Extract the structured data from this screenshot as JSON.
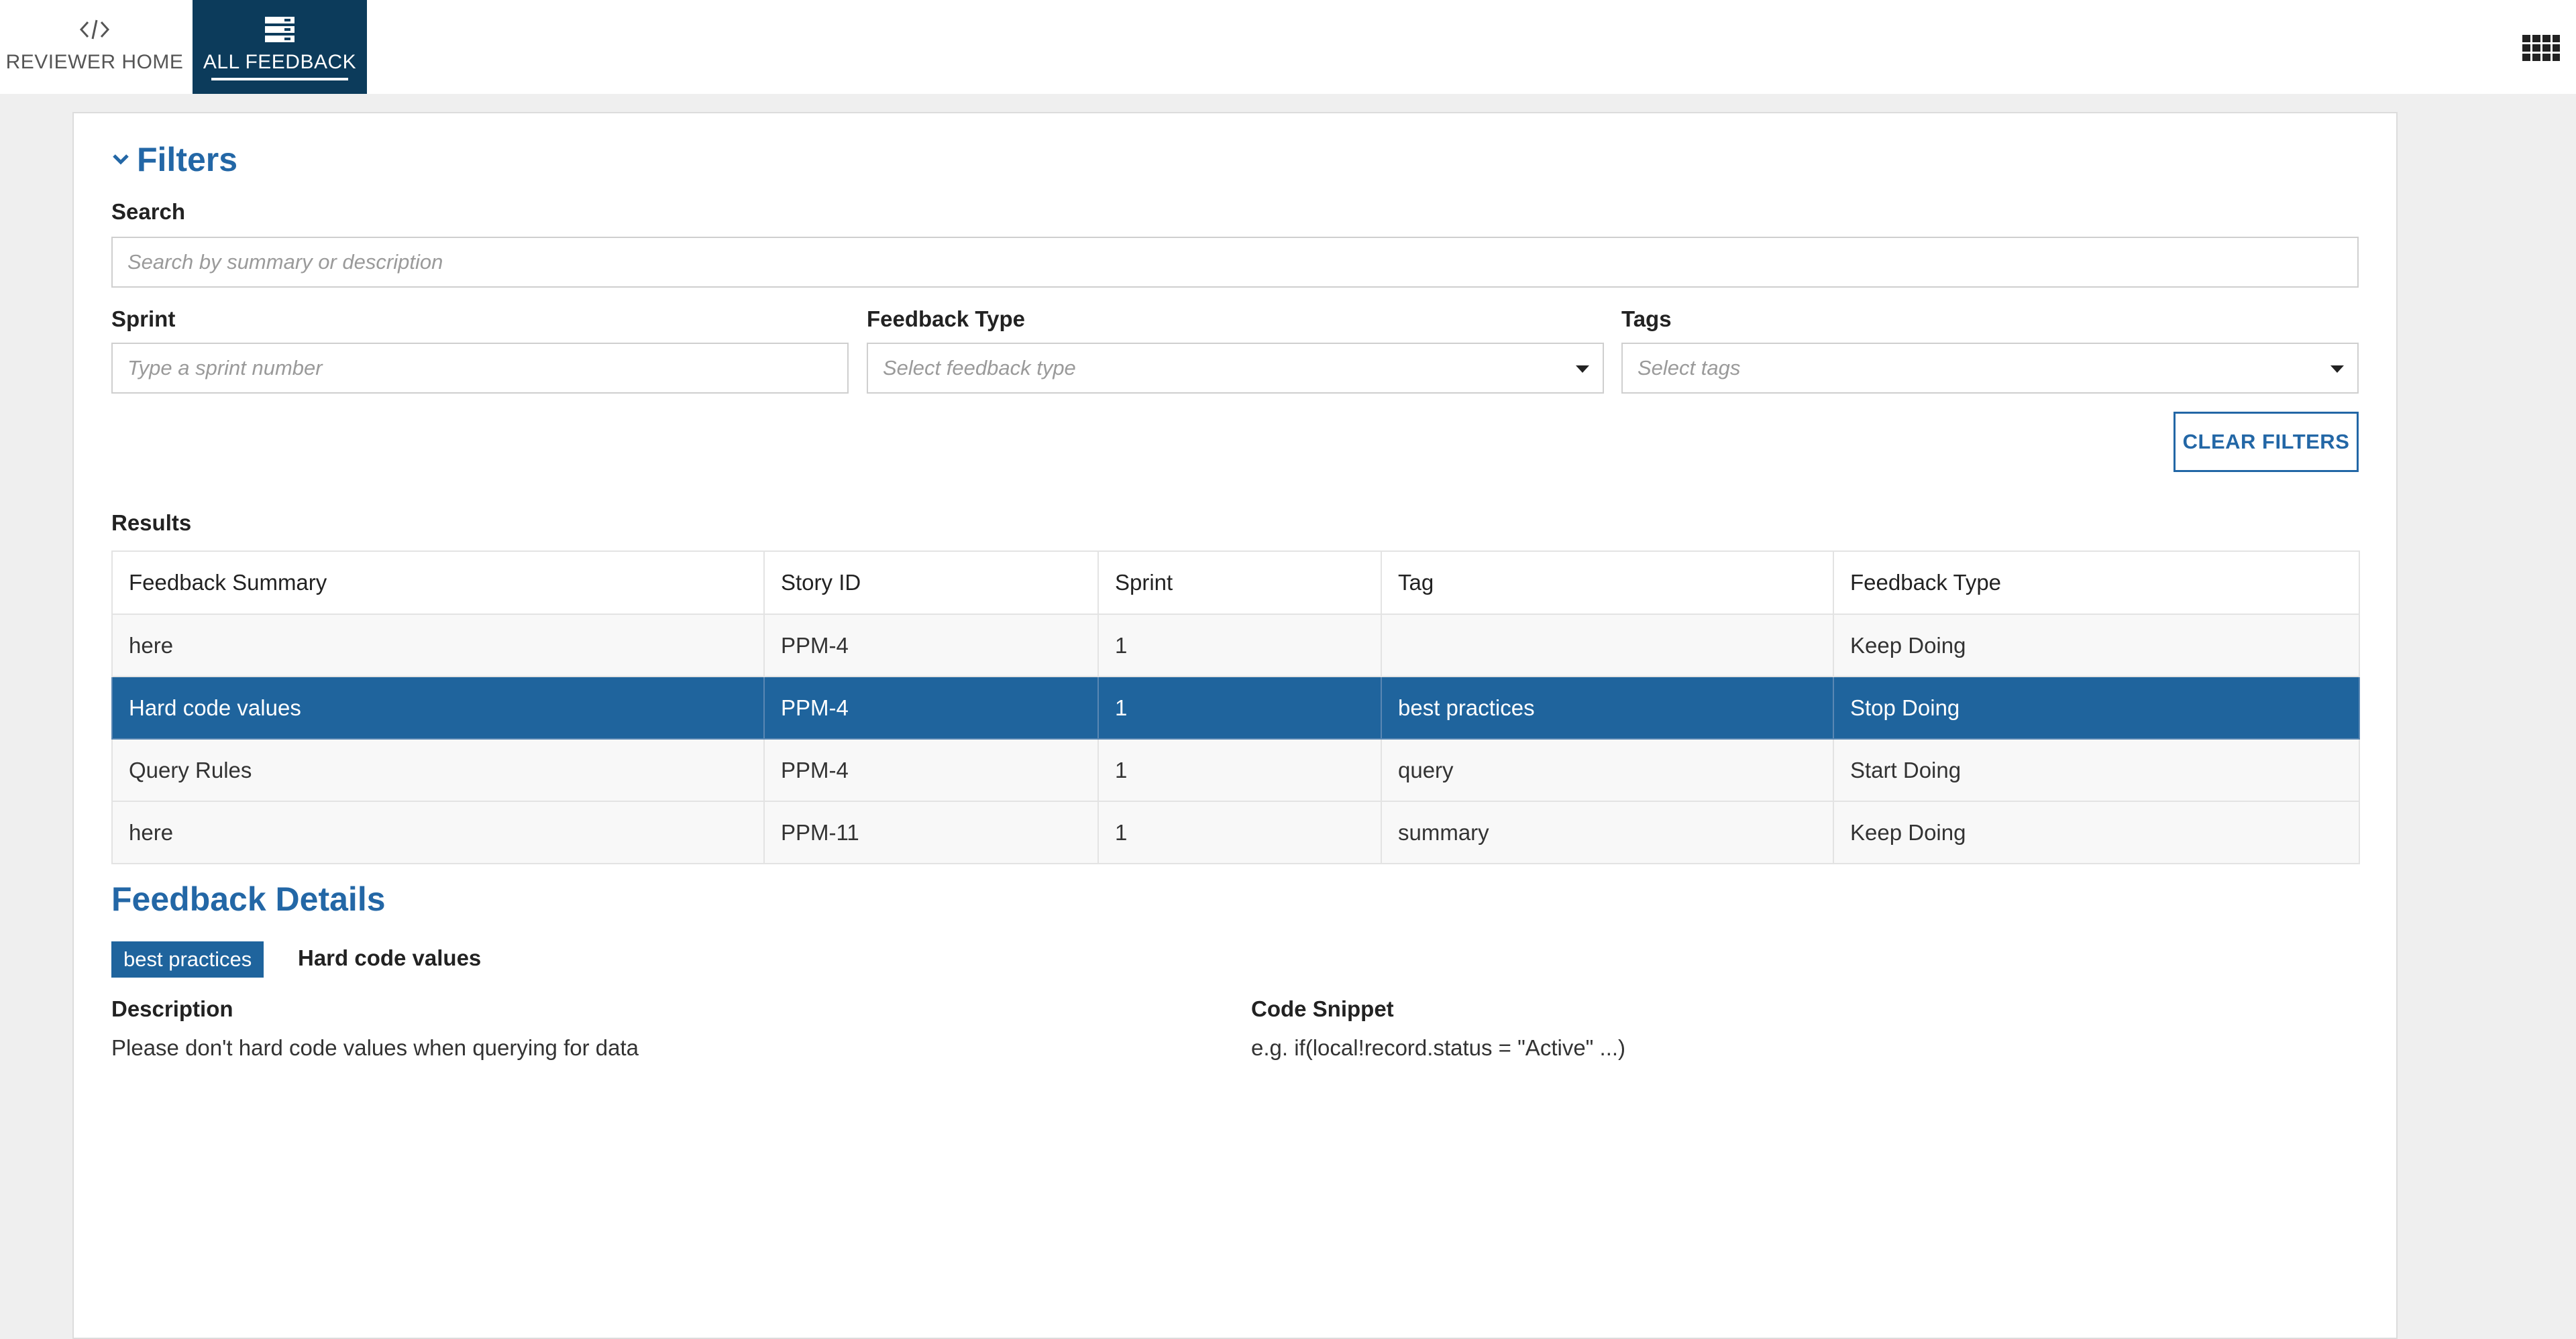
{
  "nav": {
    "tabs": [
      {
        "label": "REVIEWER HOME",
        "icon": "code-icon",
        "active": false
      },
      {
        "label": "ALL FEEDBACK",
        "icon": "list-icon",
        "active": true
      }
    ],
    "apps_icon": "app-grid-icon"
  },
  "filters": {
    "title": "Filters",
    "search": {
      "label": "Search",
      "placeholder": "Search by summary or description",
      "value": ""
    },
    "sprint": {
      "label": "Sprint",
      "placeholder": "Type a sprint number",
      "value": ""
    },
    "feedback_type": {
      "label": "Feedback Type",
      "placeholder": "Select feedback type",
      "value": ""
    },
    "tags": {
      "label": "Tags",
      "placeholder": "Select tags",
      "value": ""
    },
    "clear_label": "CLEAR FILTERS"
  },
  "results": {
    "label": "Results",
    "columns": [
      "Feedback Summary",
      "Story ID",
      "Sprint",
      "Tag",
      "Feedback Type"
    ],
    "rows": [
      {
        "summary": "here",
        "story_id": "PPM-4",
        "sprint": "1",
        "tag": "",
        "type": "Keep Doing",
        "selected": false
      },
      {
        "summary": "Hard code values",
        "story_id": "PPM-4",
        "sprint": "1",
        "tag": "best practices",
        "type": "Stop Doing",
        "selected": true
      },
      {
        "summary": "Query Rules",
        "story_id": "PPM-4",
        "sprint": "1",
        "tag": "query",
        "type": "Start Doing",
        "selected": false
      },
      {
        "summary": "here",
        "story_id": "PPM-11",
        "sprint": "1",
        "tag": "summary",
        "type": "Keep Doing",
        "selected": false
      }
    ]
  },
  "details": {
    "title": "Feedback Details",
    "tag": "best practices",
    "summary": "Hard code values",
    "description_label": "Description",
    "description": "Please don't hard code values when querying for data",
    "snippet_label": "Code Snippet",
    "snippet": "e.g. if(local!record.status = \"Active\" ...)"
  },
  "colors": {
    "nav_active": "#0c3b5b",
    "accent": "#2367a6",
    "selected_row": "#1f649d",
    "background": "#efefef"
  }
}
